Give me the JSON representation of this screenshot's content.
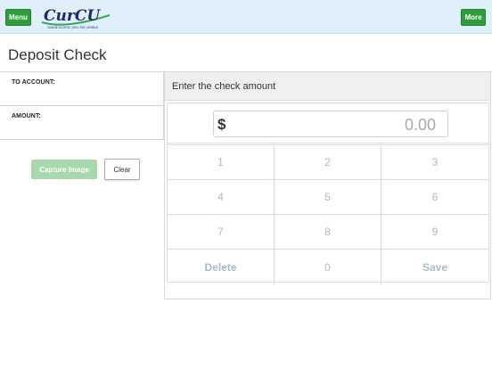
{
  "header": {
    "menu_label": "Menu",
    "more_label": "More",
    "logo_text": "CurCU",
    "logo_tagline": "ONLINE ACCESS | SELL PAY | MOBILE",
    "colors": {
      "header_bg": "#dff0fb",
      "button_green": "#2e9e3b",
      "logo_navy": "#1f2a6e",
      "logo_green": "#3aa84a"
    }
  },
  "page": {
    "title": "Deposit Check"
  },
  "form": {
    "to_account_label": "TO ACCOUNT:",
    "amount_label": "AMOUNT:",
    "capture_label": "Capture Image",
    "clear_label": "Clear"
  },
  "keypad": {
    "heading": "Enter the check amount",
    "currency_symbol": "$",
    "amount_value": "0.00",
    "keys": [
      "1",
      "2",
      "3",
      "4",
      "5",
      "6",
      "7",
      "8",
      "9",
      "Delete",
      "0",
      "Save"
    ]
  }
}
